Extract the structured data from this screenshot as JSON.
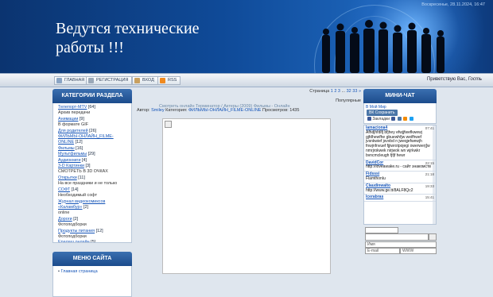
{
  "header": {
    "site_title": "Ведутся технические работы !!!",
    "date_text": "Воскресенье, 28.11.2024, 16:47"
  },
  "nav": {
    "items": [
      {
        "label": "ГЛАВНАЯ",
        "icon": "home-icon"
      },
      {
        "label": "РЕГИСТРАЦИЯ",
        "icon": "register-icon"
      },
      {
        "label": "ВХОД",
        "icon": "login-icon"
      },
      {
        "label": "RSS",
        "icon": "rss-icon"
      }
    ],
    "greeting_prefix": "Приветствую Вас,",
    "greeting_user": "Гость"
  },
  "categories": {
    "title": "КАТЕГОРИИ РАЗДЕЛА",
    "items": [
      {
        "text": "Телепорт-MTV",
        "count": "[64]",
        "link": true
      },
      {
        "text": "Архив передачи",
        "count": "",
        "link": false
      },
      {
        "text": "Анимации",
        "count": "[9]",
        "link": true
      },
      {
        "text": "В формате GIF",
        "count": "",
        "link": false
      },
      {
        "text": "Для родителей",
        "count": "[26]",
        "link": true
      },
      {
        "text": "ФИЛЬМЫ-ОНЛАЙН_FILME-ONLINE",
        "count": "[12]",
        "link": true
      },
      {
        "text": "Фильмы",
        "count": "[16]",
        "link": true
      },
      {
        "text": "Мультфильмы",
        "count": "[29]",
        "link": true
      },
      {
        "text": "Аудиокниги",
        "count": "[4]",
        "link": true
      },
      {
        "text": "3-D Картинки",
        "count": "[3]",
        "link": true
      },
      {
        "text": "СМОТРЕТЬ В 3D ОЧКАХ",
        "count": "",
        "link": false
      },
      {
        "text": "Открытки",
        "count": "[11]",
        "link": true
      },
      {
        "text": "На все праздники и не только",
        "count": "",
        "link": false
      },
      {
        "text": "СОФТ",
        "count": "[14]",
        "link": true
      },
      {
        "text": "Необходимый софт",
        "count": "",
        "link": false
      },
      {
        "text": "Журнал видеокомиксов «Каламбур»",
        "count": "[2]",
        "link": true
      },
      {
        "text": "online",
        "count": "",
        "link": false
      },
      {
        "text": "Дороги",
        "count": "[2]",
        "link": true
      },
      {
        "text": "Фотоподборки",
        "count": "",
        "link": false
      },
      {
        "text": "Продукты питания",
        "count": "[12]",
        "link": true
      },
      {
        "text": "Фотоподборки",
        "count": "",
        "link": false
      },
      {
        "text": "Ералаш онлайн",
        "count": "[5]",
        "link": true
      },
      {
        "text": "с 1974 до 1994",
        "count": "",
        "link": false
      },
      {
        "text": "Животные",
        "count": "[9]",
        "link": true
      },
      {
        "text": "Фотоподборки",
        "count": "",
        "link": false
      },
      {
        "text": "Креатив",
        "count": "[1]",
        "link": true
      }
    ]
  },
  "site_menu": {
    "title": "МЕНЮ САЙТА",
    "items": [
      "Главная страница"
    ]
  },
  "content": {
    "pager_pages": [
      "1",
      "2",
      "3",
      "...",
      "32",
      "33"
    ],
    "pager_next": "»",
    "sort": "Популярные",
    "entry_title": "Смотреть онлайн Терминатор / Актеры (2009) Фильмы - Онлайн",
    "author_label": "Автор:",
    "author": "Smiley",
    "category_label": "Категория:",
    "category": "ФИЛЬМЫ-ОНЛАЙН_FILME-ONLINE",
    "views_label": "Просмотров:",
    "views": "1435"
  },
  "chat": {
    "title": "МИНИ-ЧАТ",
    "my_world": "В Мой Мир",
    "vk_save": "Сохранить",
    "bookmarks": "Закладки",
    "messages": [
      {
        "user": "lamaciona4",
        "time": "07:41",
        "text": "Afhdjhfdlfj bfjhey efwjjfwefkwewj gjfdhewfhe gbuewhfjw weifhwef jvsnkwief jsvvbd n jweqjefwewjh fnwjnfnvuef fjjiwrotpojegi owerwerj[w nmrjrokwek nirjwok wn wjrkwkr bvncmcleugh fjfjf hewr"
      },
      {
        "user": "DavidCor",
        "time": "22:15",
        "text": "http://lovеawake.ru - сайт знакомств"
      },
      {
        "user": "Fidsssi",
        "time": "21:18",
        "text": "Flamthonlu"
      },
      {
        "user": "Claudinwalto",
        "time": "19:33",
        "text": "http://www.ge.tt/8ALF8Qc2"
      },
      {
        "user": "Icerabras",
        "time": "15:41",
        "text": ""
      }
    ],
    "smile_option": "",
    "name_placeholder": "Имя",
    "email_placeholder": "E-mail",
    "www_placeholder": "WWW"
  },
  "colors": {
    "banner": "#0f4a98",
    "link": "#1454b8",
    "block_header": "#1c4c8c"
  }
}
